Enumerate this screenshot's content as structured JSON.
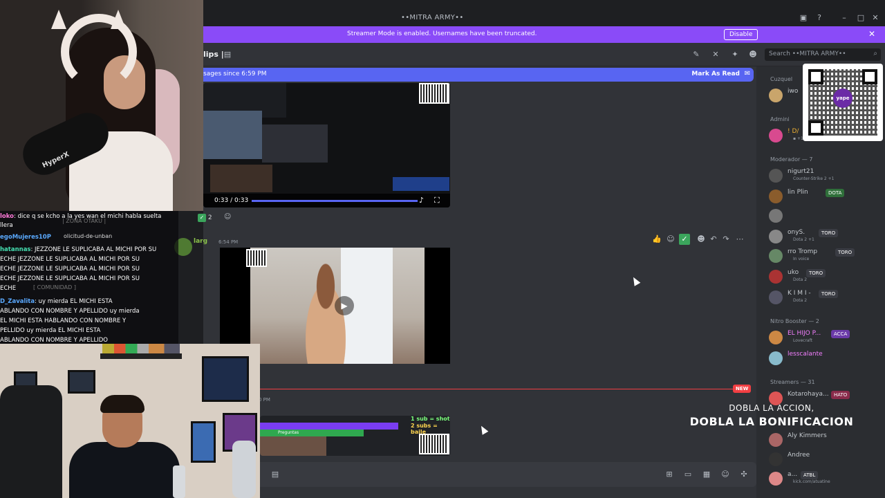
{
  "window": {
    "title": "••MITRA ARMY••",
    "minimize_icon": "minimize-icon",
    "maximize_icon": "maximize-icon",
    "close_icon": "close-icon"
  },
  "banner": {
    "message": "Streamer Mode is enabled. Usernames have been truncated.",
    "disable_label": "Disable",
    "close_glyph": "✕"
  },
  "header": {
    "channel": "lips |",
    "search_placeholder": "Search ••MITRA ARMY••"
  },
  "new_messages": {
    "text": "sages since 6:59 PM",
    "mark_label": "Mark As Read"
  },
  "message1": {
    "video_time": "0:33 / 0:33",
    "reaction_count": "2"
  },
  "message2": {
    "author": "larg",
    "time": "6:54 PM"
  },
  "divider": {
    "new_label": "NEW",
    "time": "0 PM"
  },
  "message3": {
    "overlay_line1": "1 sub = shot",
    "overlay_line2": "2 subs = baile",
    "overlay_bar_text": "Preguntas"
  },
  "members": {
    "groups": [
      {
        "label": "Cuzquel",
        "count": ""
      },
      {
        "label": "Admini",
        "count": ""
      },
      {
        "label": "Moderador — 7"
      },
      {
        "label": "Nitro Booster — 2"
      },
      {
        "label": "Streamers — 31"
      }
    ],
    "items": [
      {
        "name": "iwo",
        "status": "",
        "tag": "",
        "color": "#c9a56b"
      },
      {
        "name": "! D/",
        "status": "▪ +1",
        "tag": "",
        "color": "#d84a8f"
      },
      {
        "name": "nigurt21",
        "status": "Counter-Strike 2 +1",
        "tag": "",
        "color": "#555"
      },
      {
        "name": "lin Plin",
        "status": "",
        "tag": "DOTA",
        "color": "#8a5c2c"
      },
      {
        "name": "",
        "status": "",
        "tag": "",
        "color": "#777"
      },
      {
        "name": "onyS.",
        "status": "Dota 2 +1",
        "tag": "TORO",
        "color": "#888"
      },
      {
        "name": "rro Tromp",
        "status": "In voice",
        "tag": "TORO",
        "color": "#686"
      },
      {
        "name": "uko",
        "status": "Dota 2",
        "tag": "TORO",
        "color": "#a33"
      },
      {
        "name": "K I M I -",
        "status": "Dota 2",
        "tag": "TORO",
        "color": "#556"
      },
      {
        "name": "EL HIJO P...",
        "status": "Lovecraft",
        "tag": "ACCA",
        "color": "#c84"
      },
      {
        "name": "lesscalante",
        "status": "",
        "tag": "",
        "color": "#8bc"
      },
      {
        "name": "Kotarohaya...",
        "status": "",
        "tag": "HATO",
        "color": "#d55"
      },
      {
        "name": "Aly Kimmers",
        "status": "",
        "tag": "",
        "color": "#a66"
      },
      {
        "name": "Andree",
        "status": "",
        "tag": "",
        "color": "#333"
      },
      {
        "name": "a...",
        "status": "kick.com/atuatine",
        "tag": "ATBL",
        "color": "#d88"
      }
    ]
  },
  "qr": {
    "logo": "yape"
  },
  "promo": {
    "line1": "DOBLA LA ACCION,",
    "line2": "DOBLA LA BONIFICACION"
  },
  "chat": {
    "lines": [
      {
        "user": "loko",
        "text": ": dice q se kcho a la yes wan el michi habla suelta"
      },
      {
        "user": "",
        "text": "llera"
      },
      {
        "user": "egoMujeres10P",
        "text": ""
      },
      {
        "user": "hatannas",
        "text": ": JEZZONE LE SUPLICABA AL MICHI POR SU"
      },
      {
        "user": "",
        "text": "ECHE  JEZZONE LE SUPLICABA AL MICHI POR SU"
      },
      {
        "user": "",
        "text": "ECHE  JEZZONE LE SUPLICABA AL MICHI POR SU"
      },
      {
        "user": "",
        "text": "ECHE  JEZZONE LE SUPLICABA AL MICHI POR SU"
      },
      {
        "user": "",
        "text": "ECHE"
      },
      {
        "user": "D_Zavalita",
        "text": ": uy mierda    EL MICHI ESTA"
      },
      {
        "user": "",
        "text": "ABLANDO CON NOMBRE Y APELLIDO     uy mierda"
      },
      {
        "user": "",
        "text": "    EL MICHI ESTA HABLANDO CON NOMBRE Y"
      },
      {
        "user": "",
        "text": "PELLIDO     uy mierda     EL MICHI ESTA"
      },
      {
        "user": "",
        "text": "ABLANDO CON NOMBRE Y APELLIDO"
      }
    ],
    "ghost1": "| ZONA OTAKU |",
    "ghost2": "olicitud-de-unban",
    "ghost3": "[ COMUNIDAD ]"
  },
  "cam": {
    "mic_brand": "HyperX"
  }
}
